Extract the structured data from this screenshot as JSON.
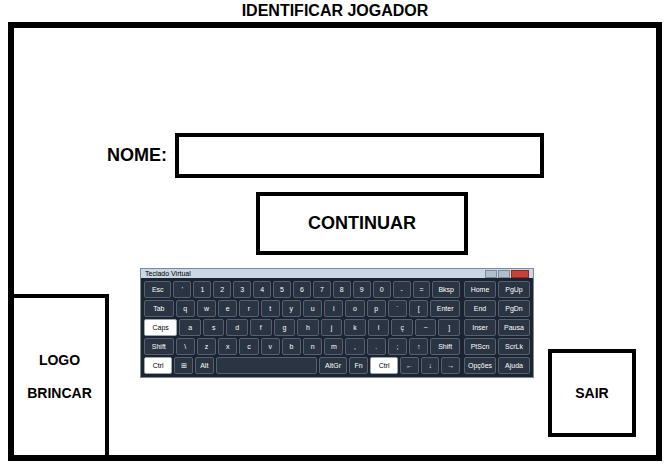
{
  "window": {
    "title": "IDENTIFICAR JOGADOR"
  },
  "form": {
    "label": "NOME:",
    "value": "",
    "button": "CONTINUAR"
  },
  "logo": {
    "lines": [
      "LOGO",
      "BRINCAR"
    ]
  },
  "exit_button": "SAIR",
  "keyboard": {
    "title": "Teclado Virtual",
    "rows": [
      [
        {
          "label": "Esc",
          "kind": "wide",
          "pressed": false
        },
        {
          "label": "'",
          "kind": "key",
          "pressed": false
        },
        {
          "label": "1",
          "kind": "key",
          "pressed": false
        },
        {
          "label": "2",
          "kind": "key",
          "pressed": false
        },
        {
          "label": "3",
          "kind": "key",
          "pressed": false
        },
        {
          "label": "4",
          "kind": "key",
          "pressed": false
        },
        {
          "label": "5",
          "kind": "key",
          "pressed": false
        },
        {
          "label": "6",
          "kind": "key",
          "pressed": false
        },
        {
          "label": "7",
          "kind": "key",
          "pressed": false
        },
        {
          "label": "8",
          "kind": "key",
          "pressed": false
        },
        {
          "label": "9",
          "kind": "key",
          "pressed": false
        },
        {
          "label": "0",
          "kind": "key",
          "pressed": false
        },
        {
          "label": "-",
          "kind": "key",
          "pressed": false
        },
        {
          "label": "=",
          "kind": "key",
          "pressed": false
        },
        {
          "label": "Bksp",
          "kind": "wide",
          "pressed": false
        }
      ],
      [
        {
          "label": "Tab",
          "kind": "wide",
          "pressed": false
        },
        {
          "label": "q",
          "kind": "key",
          "pressed": false
        },
        {
          "label": "w",
          "kind": "key",
          "pressed": false
        },
        {
          "label": "e",
          "kind": "key",
          "pressed": false
        },
        {
          "label": "r",
          "kind": "key",
          "pressed": false
        },
        {
          "label": "t",
          "kind": "key",
          "pressed": false
        },
        {
          "label": "y",
          "kind": "key",
          "pressed": false
        },
        {
          "label": "u",
          "kind": "key",
          "pressed": false
        },
        {
          "label": "i",
          "kind": "key",
          "pressed": false
        },
        {
          "label": "o",
          "kind": "key",
          "pressed": false
        },
        {
          "label": "p",
          "kind": "key",
          "pressed": false
        },
        {
          "label": "´",
          "kind": "key",
          "pressed": false
        },
        {
          "label": "[",
          "kind": "key",
          "pressed": false
        },
        {
          "label": "Enter",
          "kind": "wide",
          "pressed": false
        }
      ],
      [
        {
          "label": "Caps",
          "kind": "wide",
          "pressed": true
        },
        {
          "label": "a",
          "kind": "key",
          "pressed": false
        },
        {
          "label": "s",
          "kind": "key",
          "pressed": false
        },
        {
          "label": "d",
          "kind": "key",
          "pressed": false
        },
        {
          "label": "f",
          "kind": "key",
          "pressed": false
        },
        {
          "label": "g",
          "kind": "key",
          "pressed": false
        },
        {
          "label": "h",
          "kind": "key",
          "pressed": false
        },
        {
          "label": "j",
          "kind": "key",
          "pressed": false
        },
        {
          "label": "k",
          "kind": "key",
          "pressed": false
        },
        {
          "label": "l",
          "kind": "key",
          "pressed": false
        },
        {
          "label": "ç",
          "kind": "key",
          "pressed": false
        },
        {
          "label": "~",
          "kind": "key",
          "pressed": false
        },
        {
          "label": "]",
          "kind": "key",
          "pressed": false
        }
      ],
      [
        {
          "label": "Shift",
          "kind": "wide",
          "pressed": false
        },
        {
          "label": "\\",
          "kind": "key",
          "pressed": false
        },
        {
          "label": "z",
          "kind": "key",
          "pressed": false
        },
        {
          "label": "x",
          "kind": "key",
          "pressed": false
        },
        {
          "label": "c",
          "kind": "key",
          "pressed": false
        },
        {
          "label": "v",
          "kind": "key",
          "pressed": false
        },
        {
          "label": "b",
          "kind": "key",
          "pressed": false
        },
        {
          "label": "n",
          "kind": "key",
          "pressed": false
        },
        {
          "label": "m",
          "kind": "key",
          "pressed": false
        },
        {
          "label": ",",
          "kind": "key",
          "pressed": false
        },
        {
          "label": ".",
          "kind": "key",
          "pressed": false
        },
        {
          "label": ";",
          "kind": "key",
          "pressed": false
        },
        {
          "label": "↑",
          "kind": "key",
          "pressed": false
        },
        {
          "label": "Shift",
          "kind": "wide",
          "pressed": false
        }
      ],
      [
        {
          "label": "Ctrl",
          "kind": "wide",
          "pressed": true
        },
        {
          "label": "⊞",
          "kind": "key",
          "pressed": false
        },
        {
          "label": "Alt",
          "kind": "key",
          "pressed": false
        },
        {
          "label": "",
          "kind": "space",
          "pressed": false
        },
        {
          "label": "AltGr",
          "kind": "wide",
          "pressed": false
        },
        {
          "label": "Fn",
          "kind": "key",
          "pressed": false
        },
        {
          "label": "Ctrl",
          "kind": "wide",
          "pressed": true
        },
        {
          "label": "←",
          "kind": "key",
          "pressed": false
        },
        {
          "label": "↓",
          "kind": "key",
          "pressed": false
        },
        {
          "label": "→",
          "kind": "key",
          "pressed": false
        }
      ]
    ],
    "nav": [
      [
        "Home",
        "PgUp"
      ],
      [
        "End",
        "PgDn"
      ],
      [
        "Inser",
        "Pausa"
      ],
      [
        "PtScn",
        "ScrLk"
      ],
      [
        "Opções",
        "Ajuda"
      ]
    ]
  }
}
